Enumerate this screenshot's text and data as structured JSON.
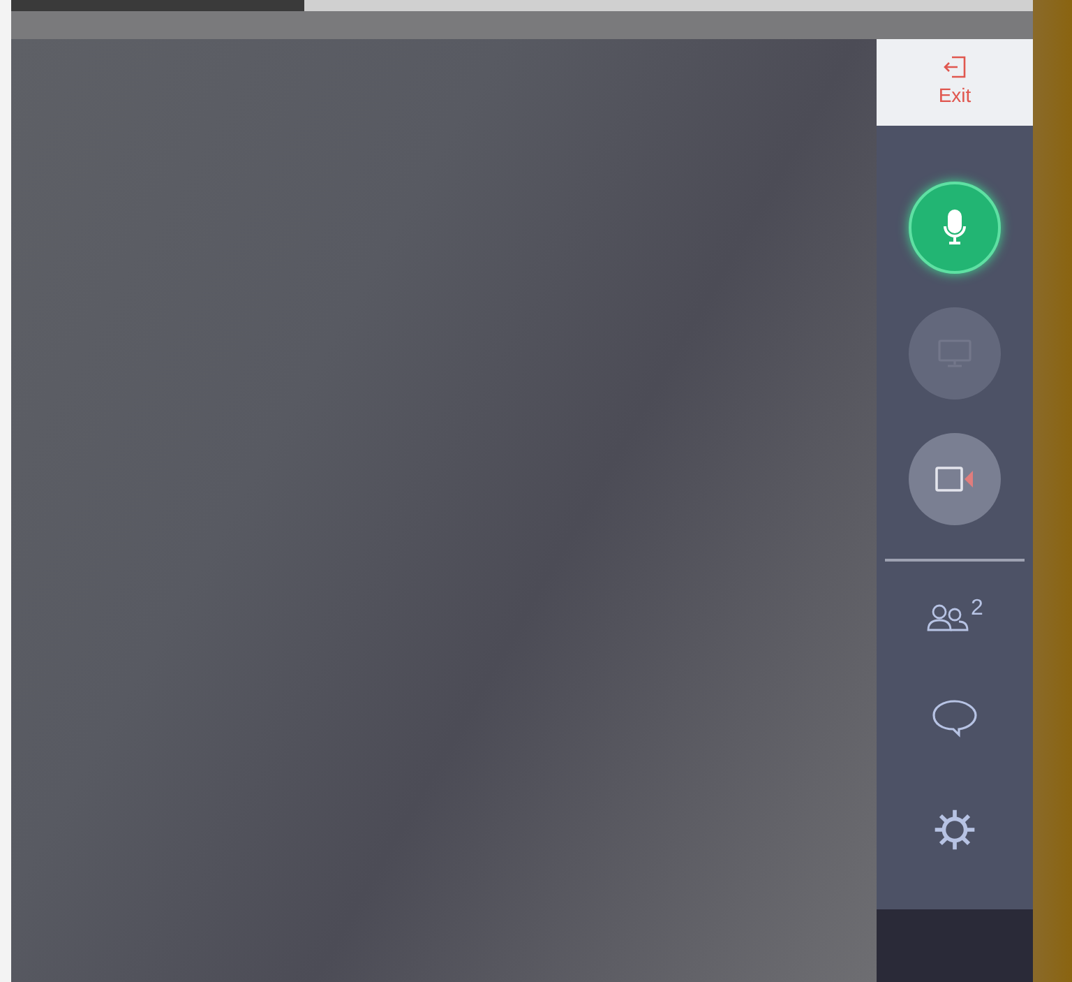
{
  "exit_button": {
    "label": "Exit"
  },
  "media_controls": [
    {
      "kind": "microphone",
      "on": true,
      "disabled": false
    },
    {
      "kind": "screen",
      "on": false,
      "disabled": true
    },
    {
      "kind": "camera",
      "on": false,
      "disabled": false
    }
  ],
  "participants": {
    "count": "2"
  }
}
